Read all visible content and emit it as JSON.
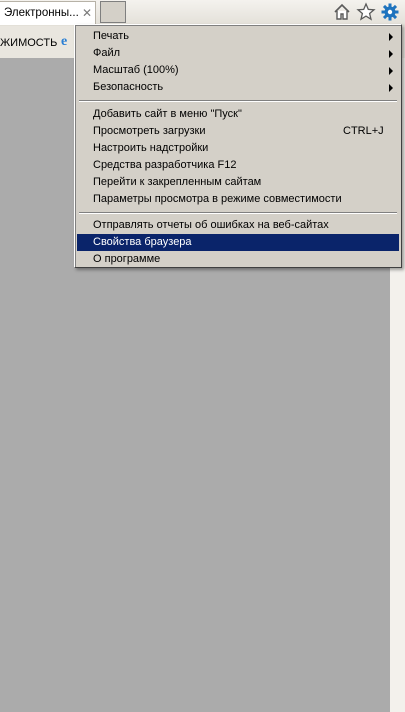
{
  "tab": {
    "title": "Электронны...",
    "close": "✕"
  },
  "toolbar": {
    "compat_label": "ЖИМОСТЬ"
  },
  "icons": {
    "home": "home-icon",
    "favorites": "star-icon",
    "tools": "gear-icon",
    "accent": "#1e73be"
  },
  "menu": {
    "group1": [
      {
        "label": "Печать",
        "submenu": true
      },
      {
        "label": "Файл",
        "submenu": true
      },
      {
        "label": "Масштаб (100%)",
        "submenu": true
      },
      {
        "label": "Безопасность",
        "submenu": true
      }
    ],
    "group2": [
      {
        "label": "Добавить сайт в меню \"Пуск\""
      },
      {
        "label": "Просмотреть загрузки",
        "shortcut": "CTRL+J"
      },
      {
        "label": "Настроить надстройки"
      },
      {
        "label": "Средства разработчика F12"
      },
      {
        "label": "Перейти к закрепленным сайтам"
      },
      {
        "label": "Параметры просмотра в режиме совместимости"
      }
    ],
    "group3": [
      {
        "label": "Отправлять отчеты об ошибках на веб-сайтах"
      },
      {
        "label": "Свойства браузера",
        "selected": true
      },
      {
        "label": "О программе"
      }
    ],
    "selection_color": "#0a246a"
  }
}
